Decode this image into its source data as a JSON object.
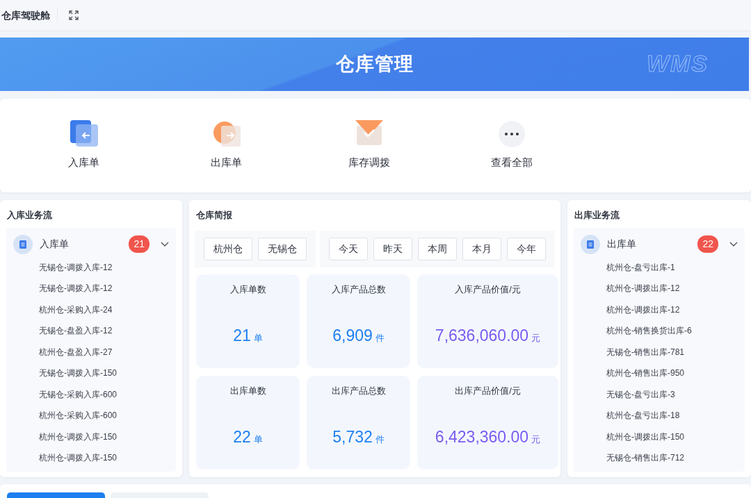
{
  "topbar": {
    "title": "仓库驾驶舱"
  },
  "banner": {
    "title": "仓库管理",
    "watermark_text": "WMS"
  },
  "quick_actions": [
    {
      "kind": "inbound",
      "label": "入库单"
    },
    {
      "kind": "outbound",
      "label": "出库单"
    },
    {
      "kind": "transfer",
      "label": "库存调拨"
    },
    {
      "kind": "more",
      "label": "查看全部"
    }
  ],
  "inbound_flow": {
    "title": "入库业务流",
    "group": {
      "label": "入库单",
      "count": "21",
      "expanded": true,
      "items": [
        "无锡仓-调拨入库-12",
        "无锡仓-调拨入库-12",
        "杭州仓-采购入库-24",
        "无锡仓-盘盈入库-12",
        "杭州仓-盘盈入库-27",
        "无锡仓-调拨入库-150",
        "无锡仓-采购入库-600",
        "杭州仓-采购入库-600",
        "杭州仓-调拨入库-150",
        "杭州仓-调拨入库-150"
      ]
    }
  },
  "brief": {
    "title": "仓库简报",
    "warehouses": [
      "杭州仓",
      "无锡仓"
    ],
    "periods": [
      "今天",
      "昨天",
      "本周",
      "本月",
      "今年"
    ],
    "stats": [
      {
        "label": "入库单数",
        "value": "21",
        "unit": "单",
        "color": "#1e7ff0"
      },
      {
        "label": "入库产品总数",
        "value": "6,909",
        "unit": "件",
        "color": "#1e7ff0"
      },
      {
        "label": "入库产品价值/元",
        "value": "7,636,060.00",
        "unit": "元",
        "color": "#7a5cf0"
      },
      {
        "label": "出库单数",
        "value": "22",
        "unit": "单",
        "color": "#1e7ff0"
      },
      {
        "label": "出库产品总数",
        "value": "5,732",
        "unit": "件",
        "color": "#1e7ff0"
      },
      {
        "label": "出库产品价值/元",
        "value": "6,423,360.00",
        "unit": "元",
        "color": "#7a5cf0"
      }
    ]
  },
  "outbound_flow": {
    "title": "出库业务流",
    "group": {
      "label": "出库单",
      "count": "22",
      "expanded": true,
      "items": [
        "杭州仓-盘亏出库-1",
        "杭州仓-调拨出库-12",
        "杭州仓-调拨出库-12",
        "杭州仓-销售换货出库-6",
        "无锡仓-销售出库-781",
        "杭州仓-销售出库-950",
        "无锡仓-盘亏出库-3",
        "杭州仓-盘亏出库-18",
        "杭州仓-调拨出库-150",
        "无锡仓-销售出库-712"
      ]
    }
  },
  "bottom_tabs": [
    {
      "selected": true
    },
    {
      "selected": false
    }
  ]
}
